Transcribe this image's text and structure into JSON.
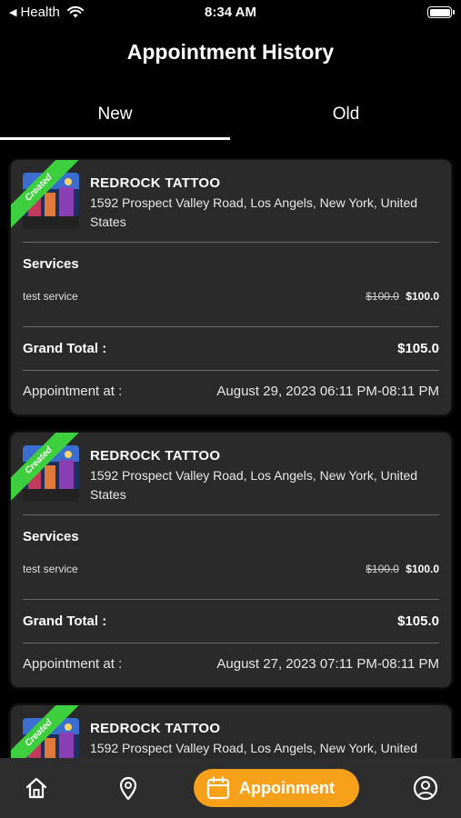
{
  "status_bar": {
    "back_app": "Health",
    "time": "8:34 AM"
  },
  "header": {
    "title": "Appointment History"
  },
  "tabs": [
    {
      "label": "New",
      "active": true
    },
    {
      "label": "Old",
      "active": false
    }
  ],
  "appointments": [
    {
      "badge": "Created",
      "shop_name": "REDROCK TATTOO",
      "address": "1592 Prospect Valley Road, Los Angels, New York, United States",
      "services_label": "Services",
      "services": [
        {
          "name": "test service",
          "original_price": "$100.0",
          "price": "$100.0"
        }
      ],
      "grand_total_label": "Grand Total :",
      "grand_total": "$105.0",
      "appointment_label": "Appointment at :",
      "appointment_time": "August 29, 2023 06:11 PM-08:11 PM"
    },
    {
      "badge": "Created",
      "shop_name": "REDROCK TATTOO",
      "address": "1592 Prospect Valley Road, Los Angels, New York, United States",
      "services_label": "Services",
      "services": [
        {
          "name": "test service",
          "original_price": "$100.0",
          "price": "$100.0"
        }
      ],
      "grand_total_label": "Grand Total :",
      "grand_total": "$105.0",
      "appointment_label": "Appointment at :",
      "appointment_time": "August 27, 2023 07:11 PM-08:11 PM"
    },
    {
      "badge": "Created",
      "shop_name": "REDROCK TATTOO",
      "address": "1592 Prospect Valley Road, Los Angels, New York, United"
    }
  ],
  "bottom_nav": {
    "items": [
      {
        "icon": "home-icon"
      },
      {
        "icon": "location-pin-icon"
      },
      {
        "icon": "calendar-icon",
        "label": "Appoinment",
        "active": true
      },
      {
        "icon": "profile-icon"
      }
    ]
  },
  "colors": {
    "accent": "#f7a11a",
    "badge": "#3ecf3e",
    "card": "#2a2a2a",
    "background": "#000000"
  }
}
